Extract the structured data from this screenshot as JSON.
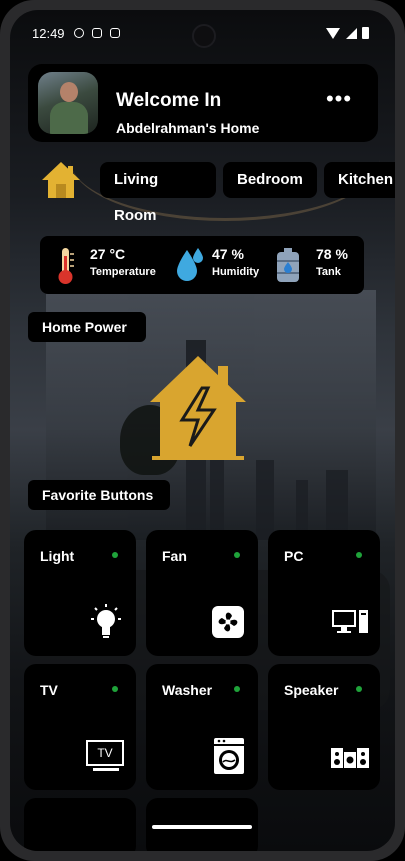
{
  "status_bar": {
    "time": "12:49"
  },
  "header": {
    "welcome": "Welcome In",
    "home_name": "Abdelrahman's Home",
    "more": "•••"
  },
  "rooms": [
    "Living Room",
    "Bedroom",
    "Kitchen"
  ],
  "sensors": [
    {
      "value": "27 °C",
      "label": "Temperature",
      "icon": "thermometer-icon"
    },
    {
      "value": "47 %",
      "label": "Humidity",
      "icon": "water-drop-icon"
    },
    {
      "value": "78 %",
      "label": "Tank",
      "icon": "water-tank-icon"
    }
  ],
  "sections": {
    "home_power": "Home Power",
    "favorites": "Favorite Buttons"
  },
  "devices": [
    {
      "label": "Light",
      "icon": "lightbulb-icon",
      "on": true
    },
    {
      "label": "Fan",
      "icon": "fan-icon",
      "on": true
    },
    {
      "label": "PC",
      "icon": "computer-icon",
      "on": true
    },
    {
      "label": "TV",
      "icon": "tv-icon",
      "on": true
    },
    {
      "label": "Washer",
      "icon": "washing-machine-icon",
      "on": true
    },
    {
      "label": "Speaker",
      "icon": "speaker-icon",
      "on": true
    }
  ],
  "tv_icon_text": "TV",
  "colors": {
    "accent_gold": "#e3b232",
    "status_on": "#1fa33a",
    "card_bg": "#000000"
  }
}
